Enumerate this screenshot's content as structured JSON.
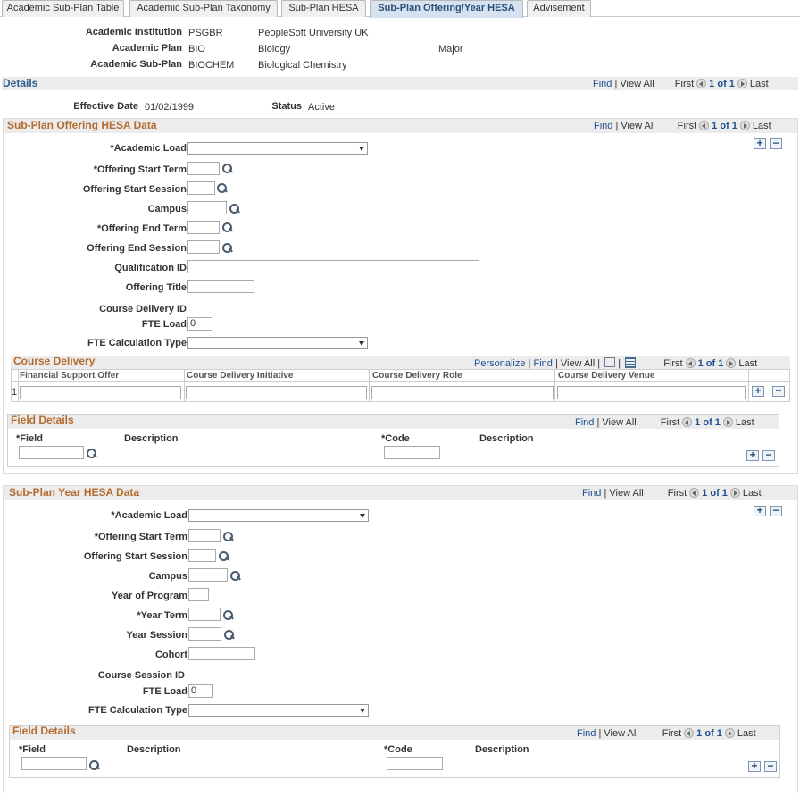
{
  "tabs": [
    "Academic Sub-Plan Table",
    "Academic Sub-Plan Taxonomy",
    "Sub-Plan HESA",
    "Sub-Plan Offering/Year HESA",
    "Advisement"
  ],
  "header": {
    "institution_label": "Academic Institution",
    "institution_code": "PSGBR",
    "institution_name": "PeopleSoft University UK",
    "plan_label": "Academic Plan",
    "plan_code": "BIO",
    "plan_name": "Biology",
    "plan_type": "Major",
    "subplan_label": "Academic Sub-Plan",
    "subplan_code": "BIOCHEM",
    "subplan_name": "Biological Chemistry"
  },
  "nav": {
    "find": "Find",
    "view_all": "View All",
    "first": "First",
    "last": "Last",
    "page": "1 of 1",
    "personalize": "Personalize",
    "sep": "|"
  },
  "details": {
    "title": "Details",
    "eff_date_label": "Effective Date",
    "eff_date": "01/02/1999",
    "status_label": "Status",
    "status": "Active"
  },
  "offering": {
    "title": "Sub-Plan Offering HESA Data",
    "academic_load": "*Academic Load",
    "start_term": "*Offering Start Term",
    "start_session": "Offering Start Session",
    "campus": "Campus",
    "end_term": "*Offering End Term",
    "end_session": "Offering End Session",
    "qualification": "Qualification ID",
    "offering_title": "Offering Title",
    "course_delivery_id": "Course Deilvery ID",
    "fte_load": "FTE Load",
    "fte_load_value": "0",
    "fte_calc": "FTE Calculation Type",
    "course_delivery": {
      "title": "Course Delivery",
      "columns": [
        "Financial Support Offer",
        "Course Delivery Initiative",
        "Course Delivery Role",
        "Course Delivery Venue"
      ],
      "row_num": "1"
    },
    "field_details": {
      "title": "Field Details",
      "field": "*Field",
      "description": "Description",
      "code": "*Code",
      "code_description": "Description"
    }
  },
  "year": {
    "title": "Sub-Plan Year HESA Data",
    "academic_load": "*Academic Load",
    "start_term": "*Offering Start Term",
    "start_session": "Offering Start Session",
    "campus": "Campus",
    "year_of_program": "Year of Program",
    "year_term": "*Year Term",
    "year_session": "Year Session",
    "cohort": "Cohort",
    "course_session_id": "Course Session ID",
    "fte_load": "FTE Load",
    "fte_load_value": "0",
    "fte_calc": "FTE Calculation Type",
    "field_details": {
      "title": "Field Details",
      "field": "*Field",
      "description": "Description",
      "code": "*Code",
      "code_description": "Description"
    }
  },
  "buttons": {
    "add": "+",
    "remove": "−"
  }
}
